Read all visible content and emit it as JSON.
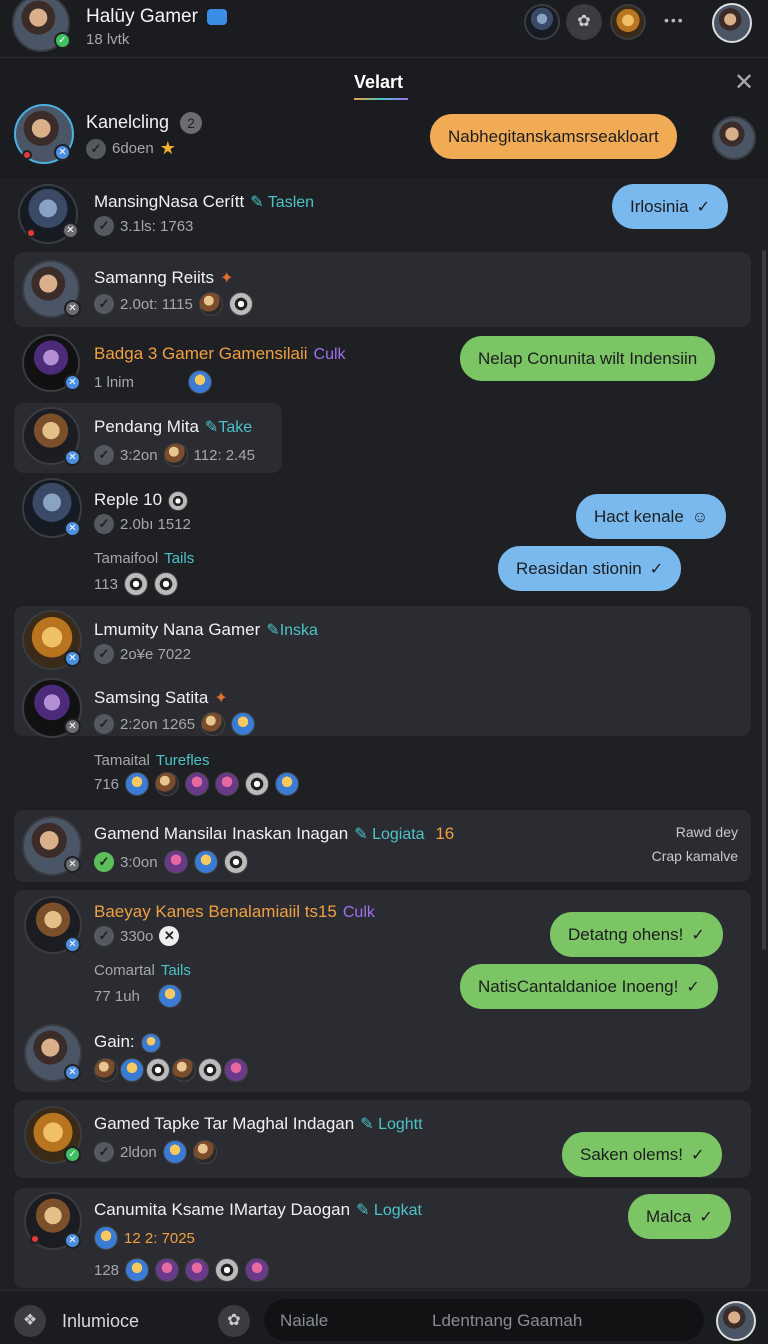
{
  "header": {
    "name": "Halūy Gamer",
    "subtitle": "18 lvtk",
    "more": "•••"
  },
  "subheader": {
    "title": "Velart",
    "close": "✕"
  },
  "pinned": {
    "name": "Kanelcling",
    "count": "2",
    "meta": "6doen",
    "bubble": "Nabhegitanskamsrseakloart"
  },
  "rows": [
    {
      "name": "MansingNasa Cerítt",
      "tag": "Taslen",
      "meta": "3.1ls: 1763",
      "bubble": "Irlosinia"
    },
    {
      "name": "Samanng Reiits",
      "meta": "2.0ot: 1115"
    },
    {
      "name": "Badga 3 Gamer Gamensilaii",
      "tag": "Culk",
      "meta": "1 lnim",
      "bubble": "Nelap Conunita wilt Indensiin"
    },
    {
      "name": "Pendang Mita",
      "tag": "Take",
      "meta": "3:2on",
      "meta2": "112: 2.45"
    },
    {
      "name": "Reple 10",
      "meta": "2.0bı 1512",
      "sub": "Tamaifool",
      "sub_tag": "Tails",
      "sub_meta": "113",
      "bubble1": "Hact kenale",
      "bubble2": "Reasidan stionin"
    },
    {
      "name": "Lmumity Nana Gamer",
      "tag": "Inska",
      "meta": "2o¥e 7022"
    },
    {
      "name": "Samsing Satita",
      "meta": "2:2on 1265",
      "sub": "Tamaital",
      "sub_tag": "Turefles",
      "sub_meta": "716"
    },
    {
      "name": "Gamend Mansilaı Inaskan Inagan",
      "tag": "Logiata",
      "tag_num": "16",
      "meta": "3:0on",
      "note1": "Rawd dey",
      "note2": "Crap kamalve"
    },
    {
      "name": "Baeyay Kanes Benalamiaiil ts15",
      "tag": "Culk",
      "meta": "330o",
      "sub": "Comartal",
      "sub_tag": "Tails",
      "sub_meta": "77 1uh",
      "bubble1": "Detatng ohens!",
      "bubble2": "NatisCantaldanioe Inoeng!"
    },
    {
      "name": "Gain:"
    },
    {
      "name": "Gamed Tapke Tar Maghal Indagan",
      "tag": "Loghtt",
      "meta": "2ldon",
      "bubble": "Saken olems!"
    },
    {
      "name": "Canumita Ksame IMartay Daogan",
      "tag": "Logkat",
      "meta": "12 2: 7025",
      "sub_meta": "128",
      "bubble": "Malca"
    }
  ],
  "footer": {
    "left_label": "Inlumioce",
    "input_left": "Naiale",
    "input_placeholder": "Ldentnang Gaamah"
  },
  "colors": {
    "bubble_blue": "#79b9ee",
    "bubble_green": "#7cc565",
    "bubble_orange": "#f2ab55",
    "accent_teal": "#4bc3c8"
  }
}
